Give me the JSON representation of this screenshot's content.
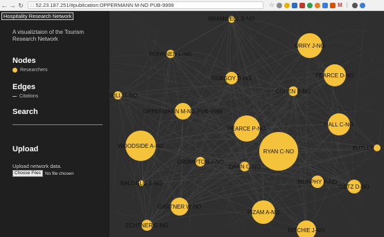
{
  "browser": {
    "url_host": "52.23.187.251",
    "url_path": "/#publication:OPPERMANN M-NO PUB-9999"
  },
  "sidebar": {
    "logo_text": "Hospitality Research Network",
    "tagline": "A visualiztaion of the Tourism Research Network",
    "nodes_title": "Nodes",
    "nodes_legend": "Researchers",
    "edges_title": "Edges",
    "edges_legend": "Citations",
    "search_title": "Search",
    "upload_title": "Upload",
    "upload_text": "Upload network data.",
    "choose_files_label": "Choose Files",
    "no_file_text": "No file chosen"
  },
  "colors": {
    "node": "#f5c33b",
    "edge": "#4a4a4a",
    "sidebar_bg": "#1f1f1f",
    "graph_bg": "#2f2f2f"
  },
  "graph": {
    "nodes": [
      {
        "label": "BRAMWELL B-NO"
      },
      {
        "label": "URRY J-NO"
      },
      {
        "label": "RUHANEN L-NO"
      },
      {
        "label": "PEARCE D-NO"
      },
      {
        "label": "GURSOY D-NO"
      },
      {
        "label": "COHEN E-NO"
      },
      {
        "label": "HARRILL R-NO"
      },
      {
        "label": "OPPERMANN M-NO PUB-9999"
      },
      {
        "label": "PEARCE P-NO"
      },
      {
        "label": "HALL C-NO"
      },
      {
        "label": "WOODSIDE A-NO"
      },
      {
        "label": "RYAN C-NO"
      },
      {
        "label": "BUTLER"
      },
      {
        "label": "CROMPTON J-NO"
      },
      {
        "label": "DANN G-NO"
      },
      {
        "label": "MURPHY P-NO"
      },
      {
        "label": "BALOGLU S-NO"
      },
      {
        "label": "GETZ D-NO"
      },
      {
        "label": "GARTNER W-NO"
      },
      {
        "label": "PIZAM A-NO"
      },
      {
        "label": "ECHTNER C-NO"
      },
      {
        "label": "RITCHIE J-NO"
      }
    ]
  }
}
